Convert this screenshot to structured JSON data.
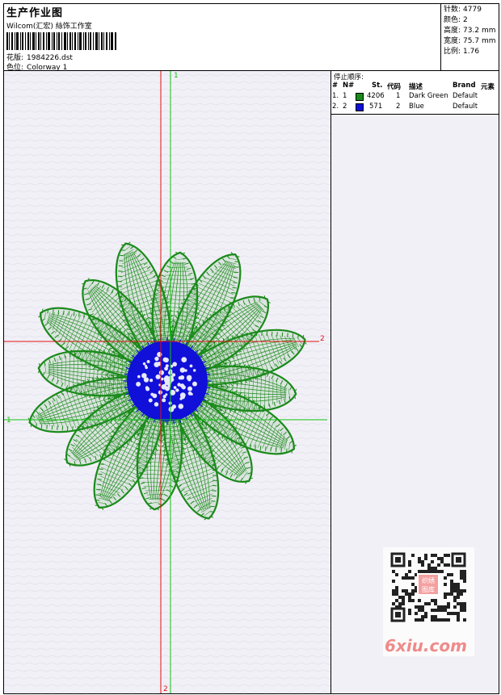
{
  "header": {
    "title": "生产作业图",
    "company": "Wilcom(汇宏) 絲饰工作室",
    "design_label": "花版:",
    "design_value": "1984226.dst",
    "colorway_label": "色位:",
    "colorway_value": "Colorway 1"
  },
  "stats": {
    "stitches_label": "针数:",
    "stitches_value": "4779",
    "colors_label": "颜色:",
    "colors_value": "2",
    "height_label": "高度:",
    "height_value": "73.2 mm",
    "width_label": "宽度:",
    "width_value": "75.7 mm",
    "ratio_label": "比例:",
    "ratio_value": "1.76"
  },
  "stop_sequence": {
    "title": "停止顺序:",
    "columns": [
      "#",
      "N#",
      "St.",
      "代码",
      "描述",
      "Brand",
      "元素"
    ],
    "rows": [
      {
        "index": "1.",
        "n": "1",
        "st": "4206",
        "code": "1",
        "desc": "Dark Green",
        "brand": "Default",
        "color": "#1a8a1a"
      },
      {
        "index": "2.",
        "n": "2",
        "st": "571",
        "code": "2",
        "desc": "Blue",
        "brand": "Default",
        "color": "#1010d8"
      }
    ]
  },
  "axes": {
    "v_red_top": "1",
    "v_red_bottom": "2",
    "h_red_right": "2",
    "h_green_left": "1"
  },
  "watermark": {
    "site": "6xiu.com",
    "stamp": "织绣图库"
  },
  "colors": {
    "green_thread": "#1a8a1a",
    "blue_thread": "#1010d8",
    "red_axis": "#e01010",
    "green_axis": "#10c010"
  }
}
